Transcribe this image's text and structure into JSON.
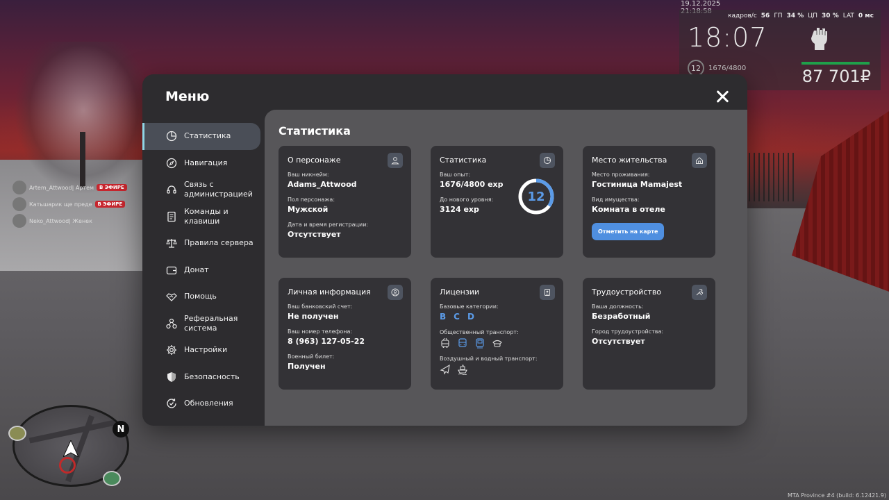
{
  "hud": {
    "datetime": "19.12.2025 21:18:58",
    "fps_label": "кадров/с",
    "fps_value": "56",
    "gpu_label": "ГП",
    "gpu_value": "34 %",
    "cpu_label": "ЦП",
    "cpu_value": "30 %",
    "lat_label": "LAT",
    "lat_value": "0 мс",
    "time": "18:07",
    "level": "12",
    "exp": "1676/4800",
    "money": "87 701₽",
    "health_fraction": 1.0
  },
  "chat": [
    {
      "name": "Artem_Attwood| Артем",
      "badge": "В ЭФИРЕ"
    },
    {
      "name": "Катьшарик ще преде",
      "badge": "В ЭФИРЕ"
    },
    {
      "name": "Neko_Attwood| Женек",
      "badge": ""
    }
  ],
  "minimap": {
    "north": "N"
  },
  "build": "MTA Province #4 (build: 6.12421.9)",
  "menu": {
    "title": "Меню",
    "nav": [
      {
        "label": "Статистика",
        "icon": "pie-chart-icon"
      },
      {
        "label": "Навигация",
        "icon": "compass-icon"
      },
      {
        "label": "Связь с администрацией",
        "icon": "headset-icon"
      },
      {
        "label": "Команды и клавиши",
        "icon": "document-icon"
      },
      {
        "label": "Правила сервера",
        "icon": "scales-icon"
      },
      {
        "label": "Донат",
        "icon": "wallet-icon"
      },
      {
        "label": "Помощь",
        "icon": "handshake-icon"
      },
      {
        "label": "Реферальная система",
        "icon": "network-icon"
      },
      {
        "label": "Настройки",
        "icon": "gear-icon"
      },
      {
        "label": "Безопасность",
        "icon": "shield-icon"
      },
      {
        "label": "Обновления",
        "icon": "refresh-check-icon"
      }
    ],
    "content_title": "Статистика"
  },
  "cards": {
    "character": {
      "title": "О персонаже",
      "nickname_label": "Ваш никнейм:",
      "nickname": "Adams_Attwood",
      "gender_label": "Пол персонажа:",
      "gender": "Мужской",
      "reg_label": "Дата и время регистрации:",
      "reg": "Отсутствует"
    },
    "stats": {
      "title": "Статистика",
      "exp_label": "Ваш опыт:",
      "exp": "1676/4800 exp",
      "next_label": "До нового уровня:",
      "next": "3124 exp",
      "level": "12",
      "progress_fraction": 0.35
    },
    "residence": {
      "title": "Место жительства",
      "place_label": "Место проживания:",
      "place": "Гостиница Mamajest",
      "type_label": "Вид имущества:",
      "type": "Комната в отеле",
      "button": "Отметить на карте"
    },
    "personal": {
      "title": "Личная информация",
      "bank_label": "Ваш банковский счет:",
      "bank": "Не получен",
      "phone_label": "Ваш номер телефона:",
      "phone": "8 (963) 127-05-22",
      "military_label": "Военный билет:",
      "military": "Получен"
    },
    "licenses": {
      "title": "Лицензии",
      "base_label": "Базовые категории:",
      "categories": [
        "B",
        "C",
        "D"
      ],
      "public_label": "Общественный транспорт:",
      "air_label": "Воздушный и водный транспорт:"
    },
    "employment": {
      "title": "Трудоустройство",
      "position_label": "Ваша должность:",
      "position": "Безработный",
      "city_label": "Город трудоустройства:",
      "city": "Отсутствует"
    }
  },
  "colors": {
    "accent": "#5b9be8",
    "active_bar": "#8fd6e6",
    "badge": "#c7262e"
  }
}
